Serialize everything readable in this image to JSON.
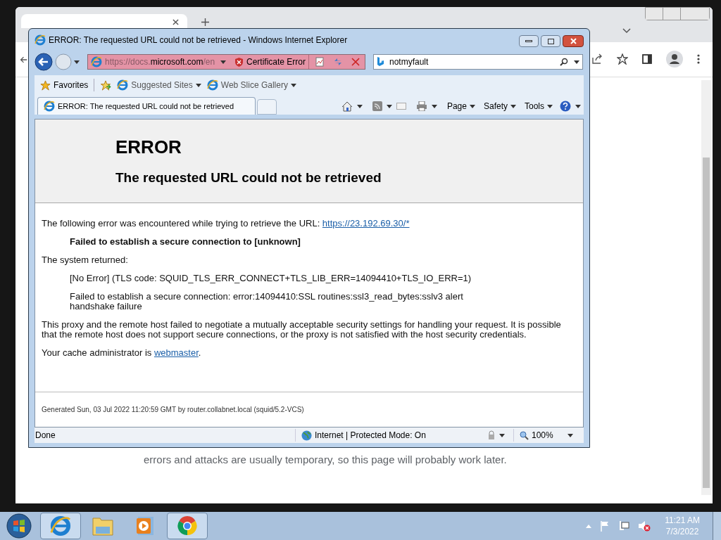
{
  "background_window": {
    "page_text": "errors and attacks are usually temporary, so this page will probably work later."
  },
  "ie_window": {
    "title": "ERROR: The requested URL could not be retrieved - Windows Internet Explorer",
    "address": {
      "url": "https://docs.**microsoft.com**/en",
      "status": "Certificate Error"
    },
    "search": {
      "value": "notmyfault"
    },
    "favorites": {
      "label": "Favorites",
      "links": [
        "Suggested Sites",
        "Web Slice Gallery"
      ]
    },
    "tabs": [
      {
        "label": "ERROR: The requested URL could not be retrieved",
        "selected": true
      }
    ],
    "command_bar": [
      "Page",
      "Safety",
      "Tools"
    ],
    "page": {
      "heading": "ERROR",
      "subheading": "The requested URL could not be retrieved",
      "blocks": [
        {
          "kind": "text",
          "text": "The following error was encountered while trying to retrieve the URL: ",
          "link": "https://23.192.69.30/*"
        },
        {
          "kind": "emphasis",
          "text": "Failed to establish a secure connection to [unknown]"
        },
        {
          "kind": "text",
          "text": "The system returned:"
        },
        {
          "kind": "indent",
          "text": "[No Error] (TLS code: SQUID_TLS_ERR_CONNECT+TLS_LIB_ERR=14094410+TLS_IO_ERR=1)"
        },
        {
          "kind": "indent",
          "text": "Failed to establish a secure connection: error:14094410:SSL routines:ssl3_read_bytes:sslv3 alert handshake failure"
        },
        {
          "kind": "text",
          "text": "This proxy and the remote host failed to negotiate a mutually acceptable security settings for handling your request. It is possible that the remote host does not support secure connections, or the proxy is not satisfied with the host security credentials."
        },
        {
          "kind": "text",
          "text": "Your cache administrator is ",
          "link": "webmaster",
          "after": "."
        }
      ],
      "footer": "Generated Sun, 03 Jul 2022 11:20:59 GMT by router.collabnet.local (squid/5.2-VCS)"
    },
    "status_bar": {
      "text": "Done",
      "zone": "Internet | Protected Mode: On",
      "zoom": "100%"
    }
  },
  "taskbar": {
    "apps": [
      {
        "kind": "ie",
        "running": true
      },
      {
        "kind": "explorer",
        "running": false
      },
      {
        "kind": "media",
        "running": false
      },
      {
        "kind": "chrome",
        "running": true
      }
    ],
    "clock": {
      "time": "11:21 AM",
      "date": "7/3/2022"
    }
  }
}
